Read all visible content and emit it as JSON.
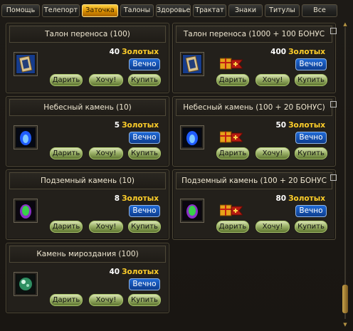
{
  "tabs": [
    {
      "label": "Помощь",
      "active": false
    },
    {
      "label": "Телепорт",
      "active": false
    },
    {
      "label": "Заточка",
      "active": true
    },
    {
      "label": "Талоны",
      "active": false
    },
    {
      "label": "Здоровье",
      "active": false
    },
    {
      "label": "Трактат",
      "active": false
    },
    {
      "label": "Знаки",
      "active": false
    },
    {
      "label": "Титулы",
      "active": false
    },
    {
      "label": "Все",
      "active": false
    }
  ],
  "items": [
    {
      "title": "Талон переноса (100)",
      "price": "40",
      "currency": "Золотых",
      "duration": "Вечно",
      "icon": "transfer-ticket-icon",
      "bonus": false,
      "checkbox": false,
      "buttons": {
        "gift": "Дарить",
        "want": "Хочу!",
        "buy": "Купить"
      }
    },
    {
      "title": "Талон переноса (1000 + 100 БОНУС",
      "price": "400",
      "currency": "Золотых",
      "duration": "Вечно",
      "icon": "transfer-ticket-icon",
      "bonus": true,
      "checkbox": true,
      "buttons": {
        "gift": "Дарить",
        "want": "Хочу!",
        "buy": "Купить"
      }
    },
    {
      "title": "Небесный камень (10)",
      "price": "5",
      "currency": "Золотых",
      "duration": "Вечно",
      "icon": "heavenly-stone-icon",
      "bonus": false,
      "checkbox": false,
      "buttons": {
        "gift": "Дарить",
        "want": "Хочу!",
        "buy": "Купить"
      }
    },
    {
      "title": "Небесный камень (100 + 20 БОНУС)",
      "price": "50",
      "currency": "Золотых",
      "duration": "Вечно",
      "icon": "heavenly-stone-icon",
      "bonus": true,
      "checkbox": true,
      "buttons": {
        "gift": "Дарить",
        "want": "Хочу!",
        "buy": "Купить"
      }
    },
    {
      "title": "Подземный камень (10)",
      "price": "8",
      "currency": "Золотых",
      "duration": "Вечно",
      "icon": "underground-stone-icon",
      "bonus": false,
      "checkbox": false,
      "buttons": {
        "gift": "Дарить",
        "want": "Хочу!",
        "buy": "Купить"
      }
    },
    {
      "title": "Подземный камень (100 + 20 БОНУС",
      "price": "80",
      "currency": "Золотых",
      "duration": "Вечно",
      "icon": "underground-stone-icon",
      "bonus": true,
      "checkbox": true,
      "buttons": {
        "gift": "Дарить",
        "want": "Хочу!",
        "buy": "Купить"
      }
    },
    {
      "title": "Камень мироздания (100)",
      "price": "40",
      "currency": "Золотых",
      "duration": "Вечно",
      "icon": "creation-stone-icon",
      "bonus": false,
      "checkbox": false,
      "buttons": {
        "gift": "Дарить",
        "want": "Хочу!",
        "buy": "Купить"
      }
    }
  ],
  "colors": {
    "accent_tab": "#e0a000",
    "currency_text": "#ffcf2a",
    "duration_badge": "#1f6ad6",
    "action_button": "#9db36a"
  }
}
